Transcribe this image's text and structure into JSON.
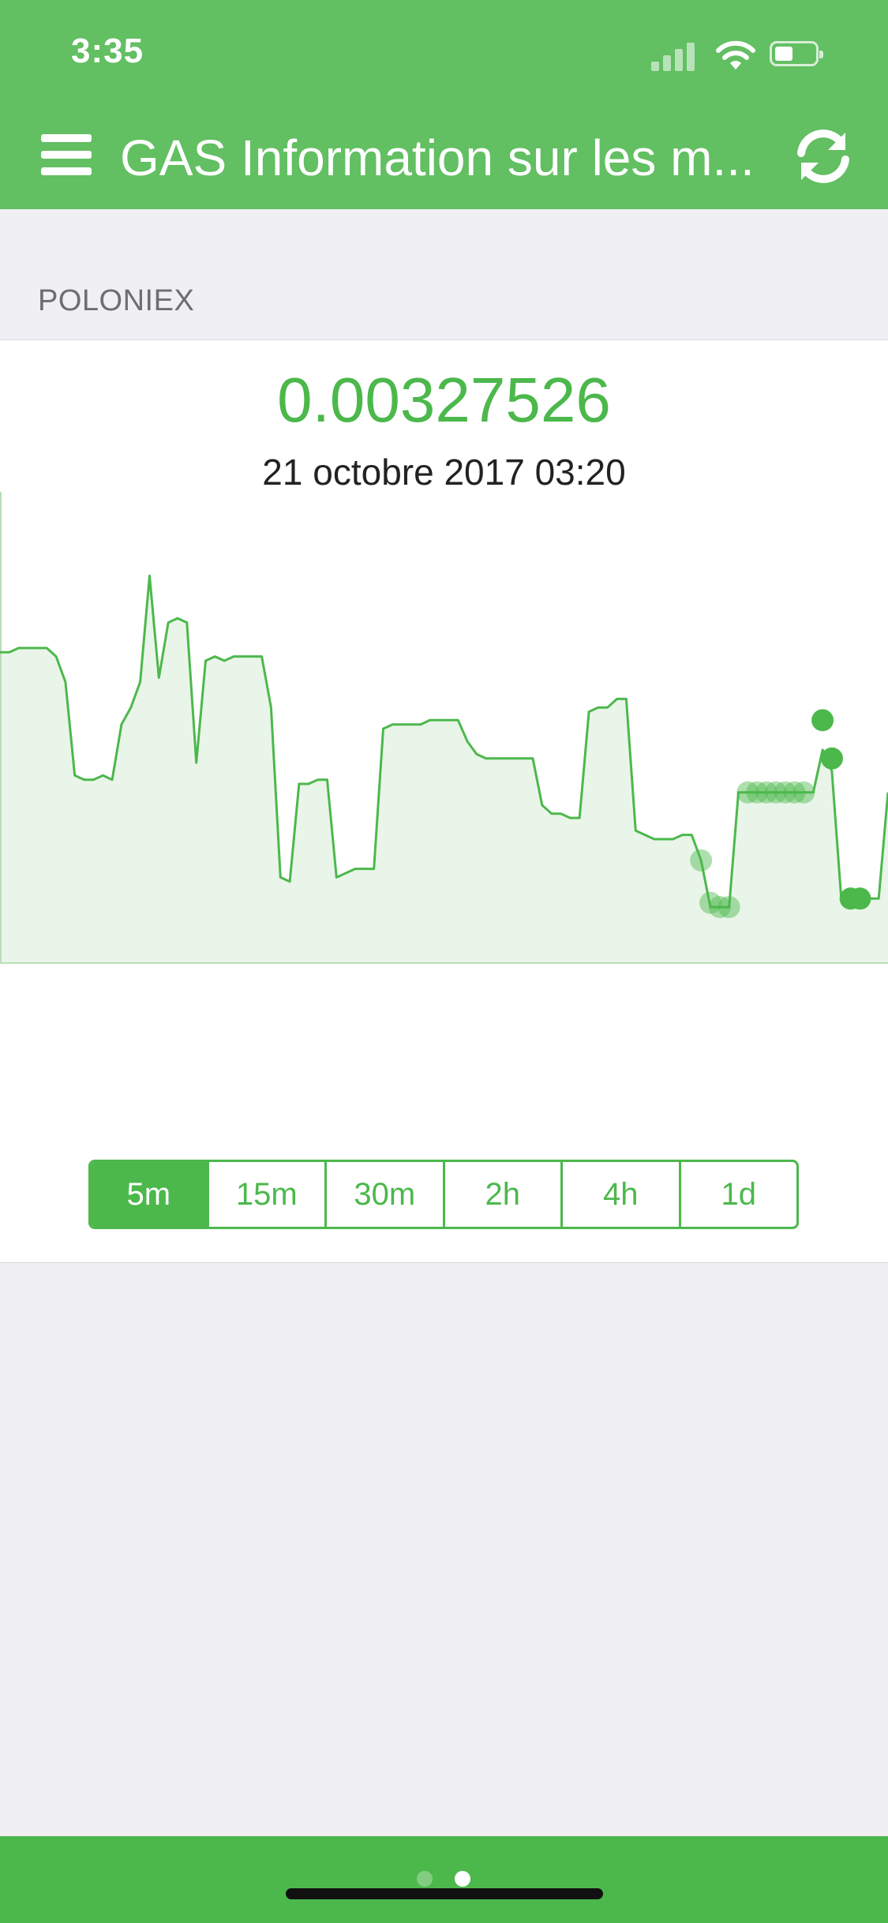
{
  "status_bar": {
    "time": "3:35"
  },
  "nav": {
    "title": "GAS Information sur les m..."
  },
  "section": {
    "label": "POLONIEX"
  },
  "price_card": {
    "price": "0.00327526",
    "date": "21 octobre 2017 03:20"
  },
  "intervals": {
    "items": [
      "5m",
      "15m",
      "30m",
      "2h",
      "4h",
      "1d"
    ],
    "selected": "5m"
  },
  "colors": {
    "accent": "#4cb84c",
    "header": "#62bf62",
    "background": "#efeff4",
    "area_fill": "#e9f5e9"
  },
  "icons": [
    "menu-icon",
    "refresh-icon",
    "signal-icon",
    "wifi-icon",
    "battery-icon"
  ],
  "chart_data": {
    "type": "area",
    "title": "",
    "xlabel": "",
    "ylabel": "",
    "grid": false,
    "ylim": [
      0,
      100
    ],
    "values": [
      73,
      73,
      74,
      74,
      74,
      74,
      72,
      66,
      44,
      43,
      43,
      44,
      43,
      56,
      60,
      66,
      91,
      67,
      80,
      81,
      80,
      47,
      71,
      72,
      71,
      72,
      72,
      72,
      72,
      60,
      20,
      19,
      42,
      42,
      43,
      43,
      20,
      21,
      22,
      22,
      22,
      55,
      56,
      56,
      56,
      56,
      57,
      57,
      57,
      57,
      52,
      49,
      48,
      48,
      48,
      48,
      48,
      48,
      37,
      35,
      35,
      34,
      34,
      59,
      60,
      60,
      62,
      62,
      31,
      30,
      29,
      29,
      29,
      30,
      30,
      24,
      13,
      13,
      13,
      40,
      40,
      40,
      40,
      40,
      40,
      40,
      40,
      40,
      50,
      45,
      15,
      15,
      15,
      15,
      15,
      40
    ],
    "markers": [
      {
        "index": 75,
        "value": 24
      },
      {
        "index": 76,
        "value": 14
      },
      {
        "index": 77,
        "value": 13
      },
      {
        "index": 78,
        "value": 13
      },
      {
        "index": 80,
        "value": 40
      },
      {
        "index": 81,
        "value": 40
      },
      {
        "index": 82,
        "value": 40
      },
      {
        "index": 83,
        "value": 40
      },
      {
        "index": 84,
        "value": 40
      },
      {
        "index": 85,
        "value": 40
      },
      {
        "index": 86,
        "value": 40
      },
      {
        "index": 88,
        "value": 57
      },
      {
        "index": 89,
        "value": 48
      },
      {
        "index": 91,
        "value": 15
      },
      {
        "index": 92,
        "value": 15
      }
    ]
  }
}
